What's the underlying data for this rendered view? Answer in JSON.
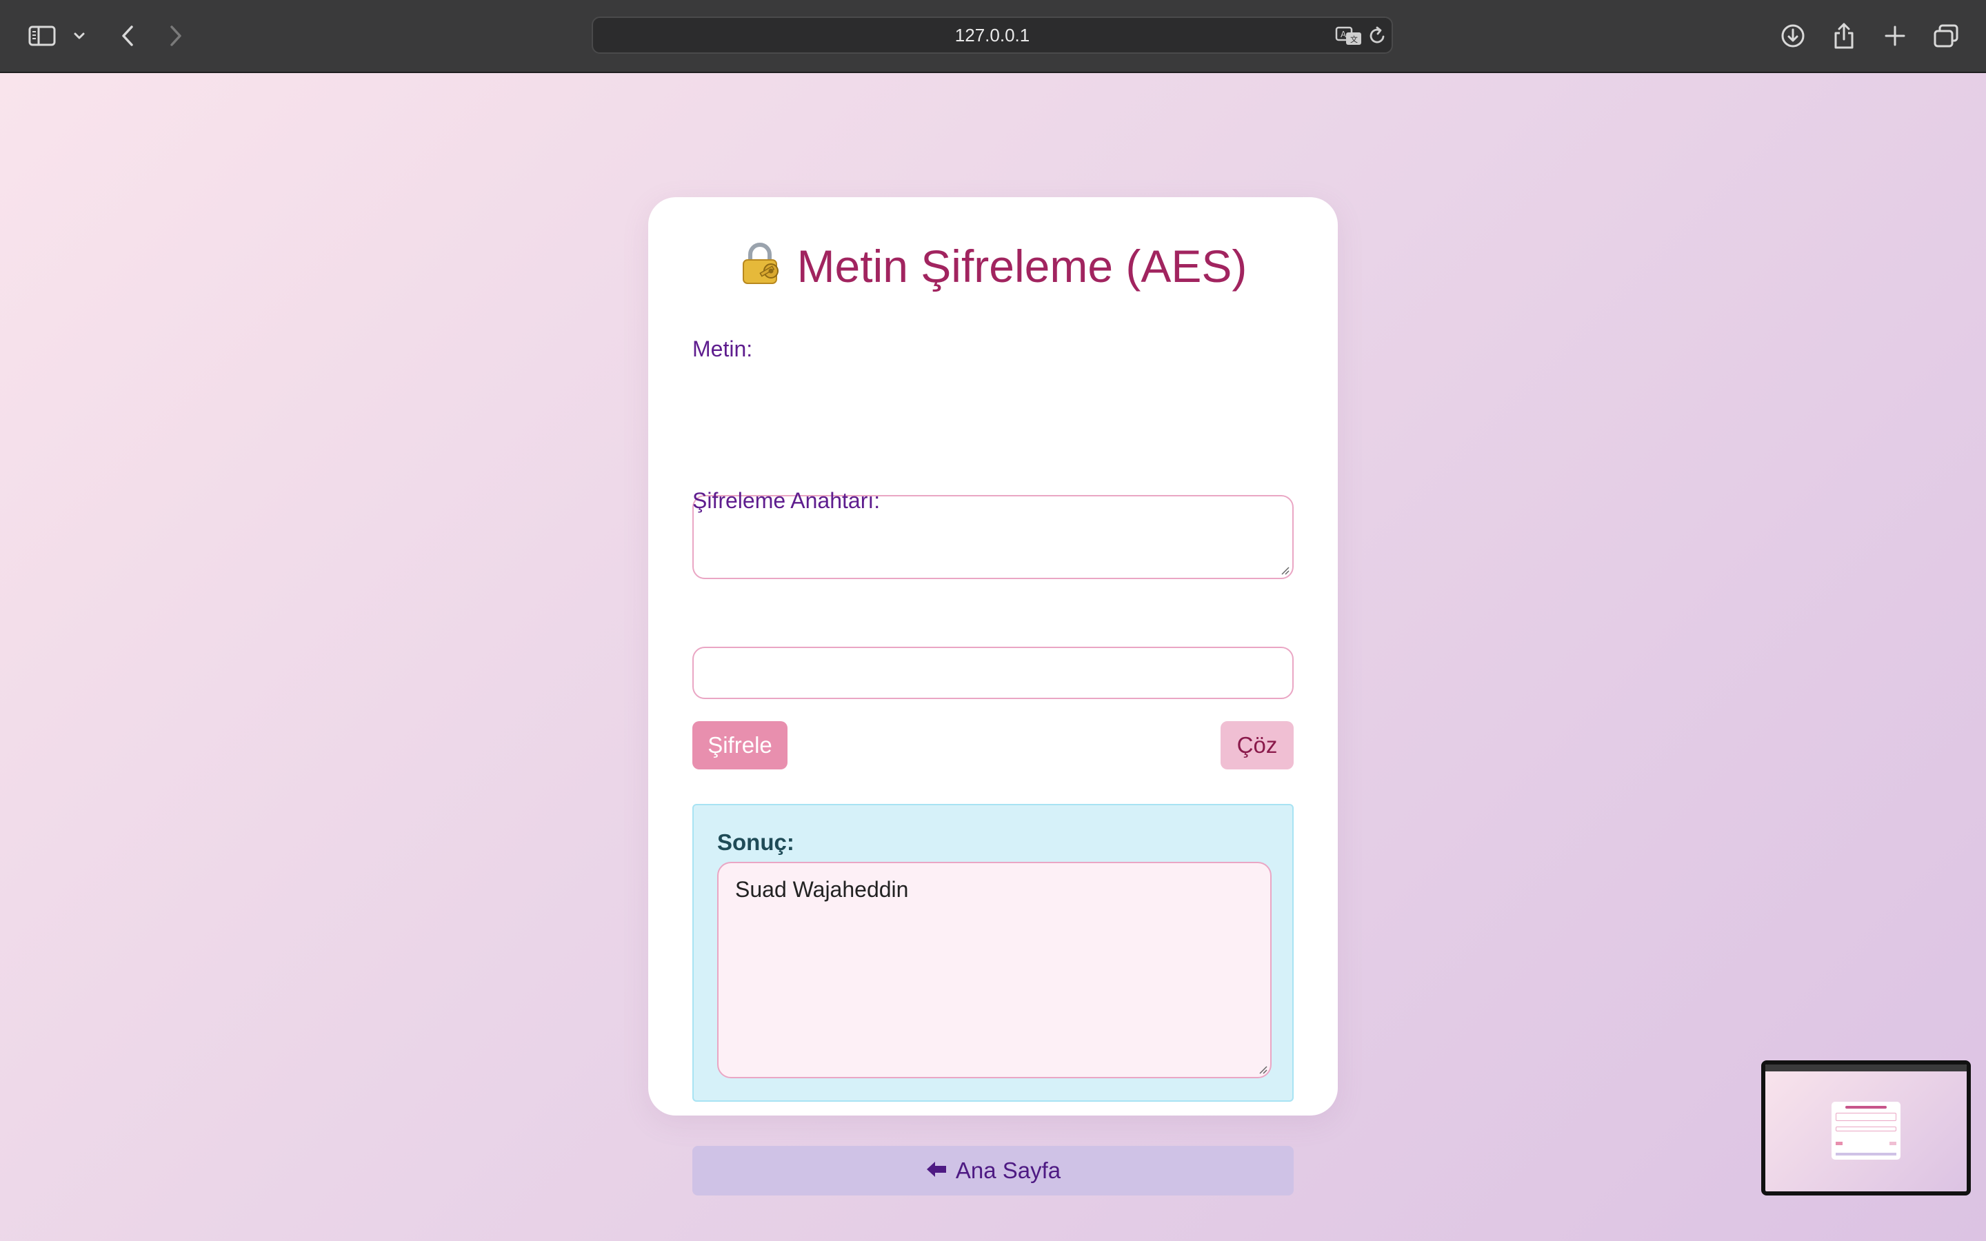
{
  "browser": {
    "url": "127.0.0.1",
    "icons": {
      "sidebar": "sidebar-icon",
      "sidebar_menu": "chevron-down-icon",
      "back": "chevron-left-icon",
      "forward": "chevron-right-icon",
      "translate": "translate-icon",
      "reload": "reload-icon",
      "download": "download-icon",
      "share": "share-icon",
      "new_tab": "plus-icon",
      "tabs": "tabs-overview-icon"
    }
  },
  "page": {
    "title": "Metin Şifreleme (AES)",
    "title_icon": "locked-with-key-icon",
    "text_label": "Metin:",
    "text_value": "",
    "key_label": "Şifreleme Anahtarı:",
    "key_value": "",
    "encrypt_button": "Şifrele",
    "decrypt_button": "Çöz",
    "result_label": "Sonuç:",
    "result_value": "Suad Wajaheddin",
    "home_button": "Ana Sayfa",
    "home_icon": "left-arrow-icon"
  },
  "colors": {
    "title": "#a1245f",
    "label": "#5e1d8e",
    "encrypt_button_bg": "#e88fae",
    "decrypt_button_bg": "#f0bfd3",
    "result_box_bg": "#d6f1f9",
    "home_button_bg": "#cfc2e6"
  }
}
